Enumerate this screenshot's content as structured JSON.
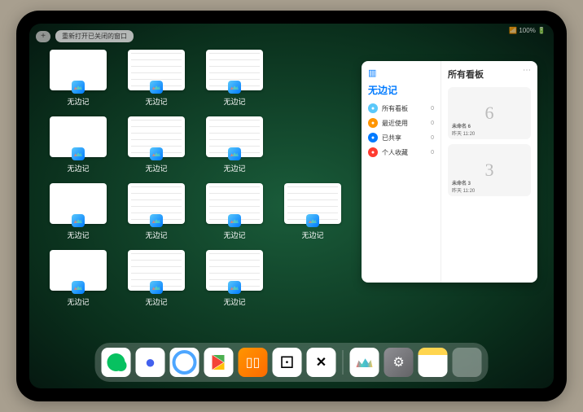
{
  "status": {
    "signal": "📶",
    "battery": "100% 🔋"
  },
  "topbar": {
    "plus": "+",
    "reopen": "重新打开已关闭的窗口"
  },
  "window_label": "无边记",
  "panel": {
    "title": "无边记",
    "right_title": "所有看板",
    "menu": [
      {
        "label": "所有看板",
        "count": "0",
        "color": "#5ac8fa"
      },
      {
        "label": "最近使用",
        "count": "0",
        "color": "#ff9500"
      },
      {
        "label": "已共享",
        "count": "0",
        "color": "#007aff"
      },
      {
        "label": "个人收藏",
        "count": "0",
        "color": "#ff3b30"
      }
    ],
    "boards": [
      {
        "sketch": "6",
        "name": "未命名 6",
        "time": "昨天 11:20"
      },
      {
        "sketch": "3",
        "name": "未命名 3",
        "time": "昨天 11:20"
      }
    ]
  },
  "windows": [
    {
      "type": "blank"
    },
    {
      "type": "detail"
    },
    {
      "type": "detail"
    },
    null,
    {
      "type": "blank"
    },
    {
      "type": "detail"
    },
    {
      "type": "detail"
    },
    null,
    {
      "type": "blank"
    },
    {
      "type": "detail"
    },
    {
      "type": "detail"
    },
    {
      "type": "detail"
    },
    {
      "type": "blank"
    },
    {
      "type": "detail"
    },
    {
      "type": "detail"
    },
    null
  ],
  "dock": [
    {
      "name": "wechat-icon",
      "cls": "i-wechat"
    },
    {
      "name": "browser1-icon",
      "cls": "i-q1",
      "glyph": "●"
    },
    {
      "name": "browser2-icon",
      "cls": "i-q2"
    },
    {
      "name": "play-icon",
      "cls": "i-play"
    },
    {
      "name": "books-icon",
      "cls": "i-books",
      "glyph": "▯▯"
    },
    {
      "name": "dice-icon",
      "cls": "i-dice",
      "glyph": "⚀"
    },
    {
      "name": "x-icon",
      "cls": "i-x",
      "glyph": "✕"
    },
    {
      "sep": true
    },
    {
      "name": "freeform-icon",
      "cls": "i-freeform"
    },
    {
      "name": "settings-icon",
      "cls": "i-settings",
      "glyph": "⚙"
    },
    {
      "name": "notes-icon",
      "cls": "i-notes"
    },
    {
      "name": "folder-icon",
      "cls": "i-folder"
    }
  ]
}
